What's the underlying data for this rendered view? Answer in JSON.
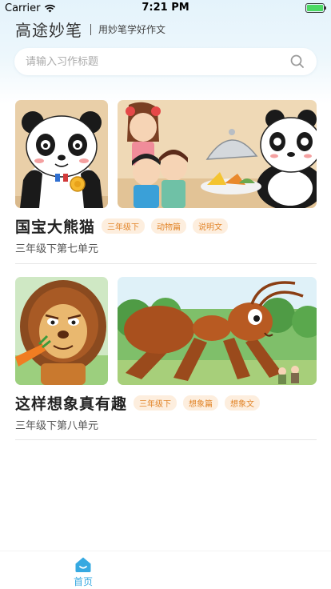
{
  "status_bar": {
    "carrier": "Carrier",
    "time": "7:21 PM",
    "battery_level": 1.0
  },
  "header": {
    "title": "高途妙笔",
    "subtitle": "用妙笔学好作文"
  },
  "search": {
    "placeholder": "请输入习作标题",
    "value": "",
    "icon": "search-icon"
  },
  "cards": [
    {
      "title": "国宝大熊猫",
      "tags": [
        "三年级下",
        "动物篇",
        "说明文"
      ],
      "unit": "三年级下第七单元",
      "images": [
        "panda-medal-illustration",
        "panda-and-children-illustration"
      ]
    },
    {
      "title": "这样想象真有趣",
      "tags": [
        "三年级下",
        "想象篇",
        "想象文"
      ],
      "unit": "三年级下第八单元",
      "images": [
        "lion-carrot-illustration",
        "giant-ant-forest-illustration"
      ]
    }
  ],
  "tabbar": {
    "items": [
      {
        "label": "首页",
        "icon": "home-icon",
        "active": true
      }
    ]
  },
  "colors": {
    "accent": "#36a9e1",
    "tag_text": "#e2862b",
    "tag_bg": "#fdeede",
    "battery": "#4cd964"
  }
}
